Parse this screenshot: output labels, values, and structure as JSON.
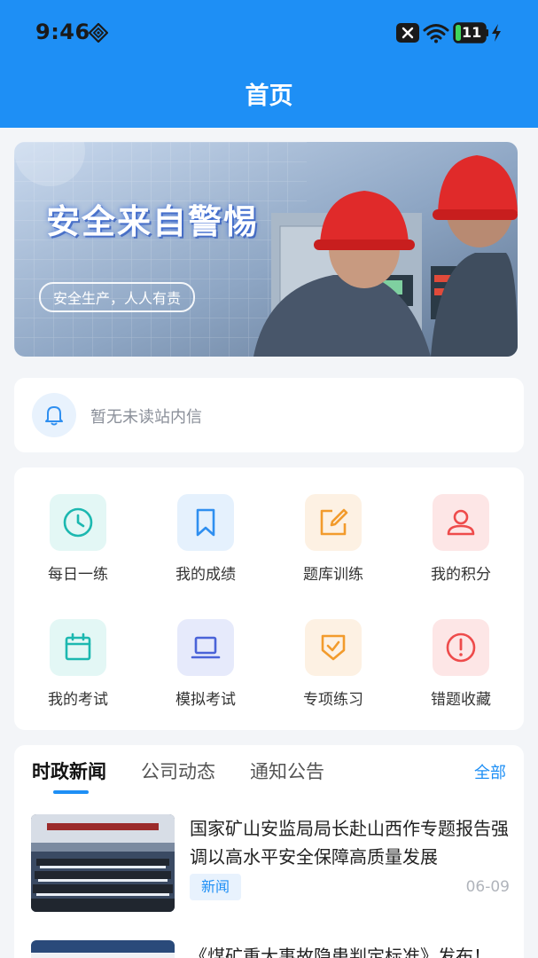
{
  "status_bar": {
    "time": "9:46",
    "battery": "11"
  },
  "header": {
    "title": "首页"
  },
  "banner": {
    "title": "安全来自警惕",
    "slogan": "安全生产，人人有责"
  },
  "notice": {
    "text": "暂无未读站内信"
  },
  "menu": [
    {
      "label": "每日一练",
      "icon": "clock-icon",
      "color": "#1cb8b0",
      "bg": "#e3f7f5"
    },
    {
      "label": "我的成绩",
      "icon": "bookmark-icon",
      "color": "#2f8ff0",
      "bg": "#e5f1fd"
    },
    {
      "label": "题库训练",
      "icon": "edit-icon",
      "color": "#f29b2c",
      "bg": "#fdf1e3"
    },
    {
      "label": "我的积分",
      "icon": "user-icon",
      "color": "#ee4b4b",
      "bg": "#fde6e6"
    },
    {
      "label": "我的考试",
      "icon": "calendar-icon",
      "color": "#1cb8b0",
      "bg": "#e3f7f5"
    },
    {
      "label": "模拟考试",
      "icon": "laptop-icon",
      "color": "#4a63d8",
      "bg": "#e6eafb"
    },
    {
      "label": "专项练习",
      "icon": "shield-check-icon",
      "color": "#f29b2c",
      "bg": "#fdf1e3"
    },
    {
      "label": "错题收藏",
      "icon": "alert-icon",
      "color": "#ee4b4b",
      "bg": "#fde6e6"
    }
  ],
  "news": {
    "tabs": [
      "时政新闻",
      "公司动态",
      "通知公告"
    ],
    "more": "全部",
    "items": [
      {
        "title": "国家矿山安监局局长赴山西作专题报告强调以高水平安全保障高质量发展",
        "tag": "新闻",
        "date": "06-09"
      },
      {
        "title": "《煤矿重大事故隐患判定标准》发布！"
      }
    ]
  }
}
